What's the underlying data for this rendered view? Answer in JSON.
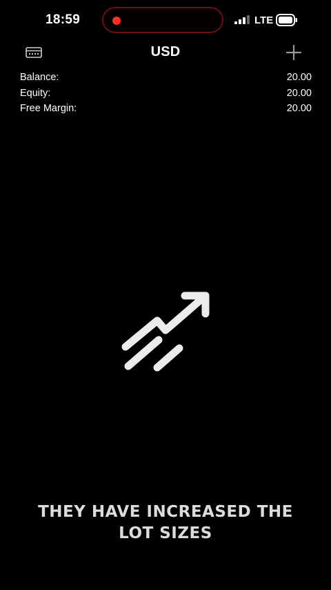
{
  "status_bar": {
    "time": "18:59",
    "network": "LTE",
    "recording_indicator_color": "#ff2a2a",
    "icons": [
      "signal-icon",
      "battery-icon"
    ]
  },
  "nav": {
    "title": "USD",
    "left_icon": "accounts-icon",
    "right_icon": "add-icon"
  },
  "summary": {
    "rows": [
      {
        "label": "Balance:",
        "value": "20.00"
      },
      {
        "label": "Equity:",
        "value": "20.00"
      },
      {
        "label": "Free Margin:",
        "value": "20.00"
      }
    ]
  },
  "center_graphic": {
    "icon": "trend-up-arrow-icon"
  },
  "caption": {
    "lines": [
      "THEY HAVE INCREASED THE",
      "LOT SIZES"
    ]
  },
  "colors": {
    "background": "#000000",
    "text": "#ffffff",
    "caption_text": "#dcdcdc",
    "island_border": "#6b0f14"
  }
}
